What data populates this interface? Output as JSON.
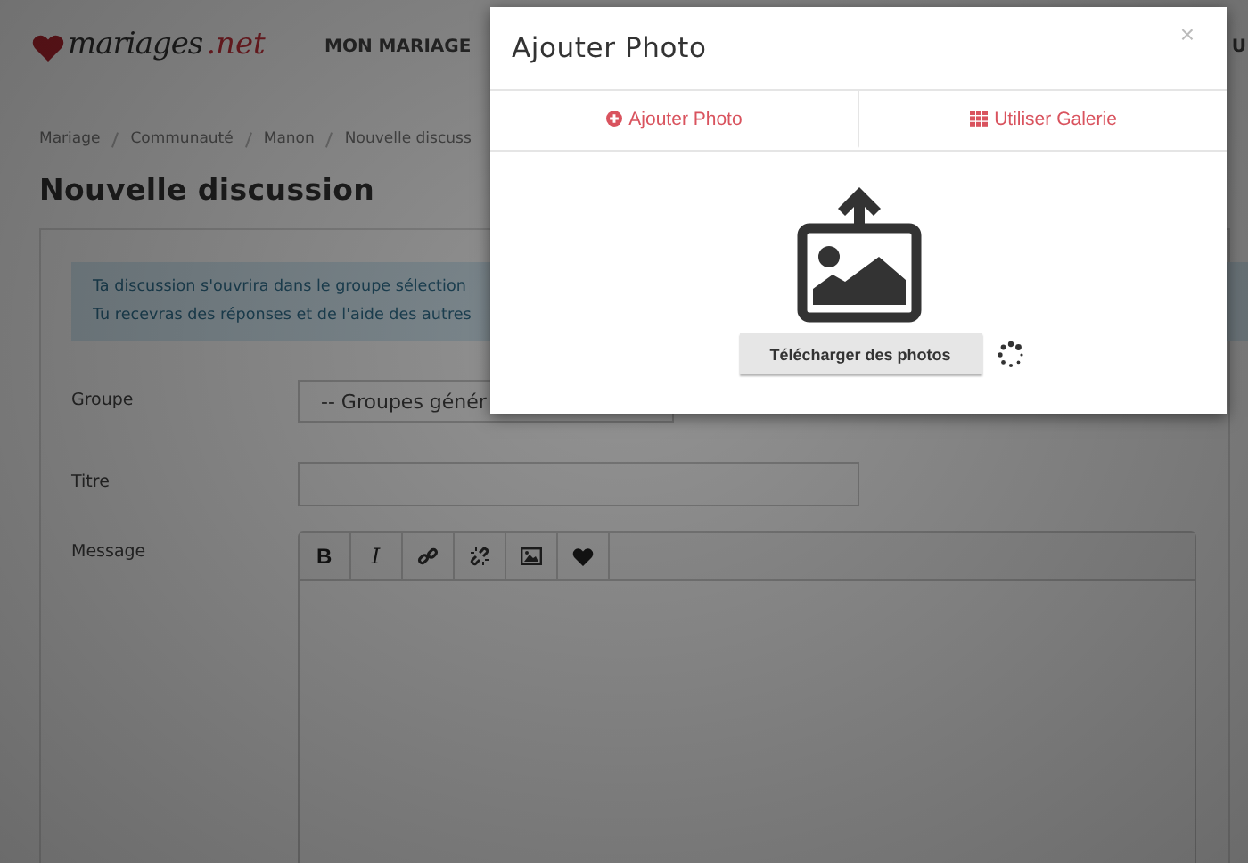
{
  "header": {
    "logo": {
      "name": "mariages",
      "suffix": ".net"
    },
    "nav": [
      {
        "label": "MON MARIAGE"
      },
      {
        "label": "U"
      }
    ]
  },
  "breadcrumb": [
    "Mariage",
    "Communauté",
    "Manon",
    "Nouvelle discuss"
  ],
  "heading": "Nouvelle discussion",
  "info": [
    "Ta discussion s'ouvrira dans le groupe sélection",
    "Tu recevras des réponses et de l'aide des autres"
  ],
  "form": [
    {
      "kind": "select",
      "label": "Groupe",
      "value": "-- Groupes génér"
    },
    {
      "kind": "text",
      "label": "Titre"
    },
    {
      "kind": "editor",
      "label": "Message",
      "toolbar": [
        {
          "kind": "bold",
          "label": "B"
        },
        {
          "kind": "italic",
          "label": "I"
        },
        {
          "kind": "link"
        },
        {
          "kind": "unlink"
        },
        {
          "kind": "image"
        },
        {
          "kind": "heart"
        }
      ]
    }
  ],
  "modal": {
    "title": "Ajouter Photo",
    "close": "×",
    "tabs": [
      {
        "kind": "add",
        "label": "Ajouter Photo",
        "selected": false
      },
      {
        "kind": "gallery",
        "label": "Utiliser Galerie",
        "selected": false
      }
    ],
    "upload_button": "Télécharger des photos",
    "loading": true
  }
}
